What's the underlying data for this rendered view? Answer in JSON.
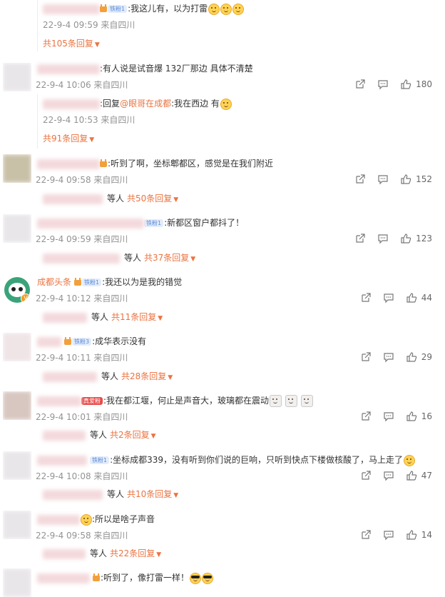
{
  "comments": [
    {
      "top_reply": {
        "text": "我这儿有，以为打雷",
        "badge": "铁粉1",
        "meta": "22-9-4 09:59 来自四川"
      },
      "more": "共105条回复"
    },
    {
      "text": "有人说是试音爆 132厂那边 具体不清楚",
      "meta": "22-9-4 10:06 来自四川",
      "likes": "180",
      "reply": {
        "prefix": "回复",
        "mention": "@眼哥在成都",
        "text": ":我在西边 有",
        "meta": "22-9-4 10:53 来自四川"
      },
      "more": "共91条回复"
    },
    {
      "text": "听到了啊，坐标郫都区，感觉是在我们附近",
      "meta": "22-9-4 09:58 来自四川",
      "likes": "152",
      "etc": "等人",
      "more": "共50条回复"
    },
    {
      "text": "新都区窗户都抖了！",
      "badge": "铁粉1",
      "meta": "22-9-4 09:59 来自四川",
      "likes": "123",
      "etc": "等人",
      "more": "共37条回复"
    },
    {
      "name": "成都头条",
      "badge": "铁粉1",
      "text": "我还以为是我的错觉",
      "meta": "22-9-4 10:12 来自四川",
      "likes": "44",
      "etc": "等人",
      "more": "共11条回复"
    },
    {
      "text": "成华表示没有",
      "badge": "铁粉3",
      "meta": "22-9-4 10:11 来自四川",
      "likes": "29",
      "etc": "等人",
      "more": "共28条回复"
    },
    {
      "text": "我在都江堰，何止是声音大，玻璃都在震动",
      "badge": "真爱粉",
      "meta": "22-9-4 10:01 来自四川",
      "likes": "16",
      "etc": "等人",
      "more": "共2条回复"
    },
    {
      "text": "坐标成都339，没有听到你们说的巨响，只听到快点下楼做核酸了，马上走了",
      "badge": "铁粉1",
      "meta": "22-9-4 10:08 来自四川",
      "likes": "47",
      "etc": "等人",
      "more": "共10条回复"
    },
    {
      "text": "所以是啥子声音",
      "meta": "22-9-4 09:58 来自四川",
      "likes": "14",
      "etc": "等人",
      "more": "共22条回复"
    },
    {
      "text": "听到了，像打雷一样！"
    }
  ],
  "icons": {
    "share": "share-icon",
    "comment": "comment-icon",
    "like": "like-icon"
  },
  "colors": {
    "accent": "#eb7340",
    "meta": "#939393"
  }
}
